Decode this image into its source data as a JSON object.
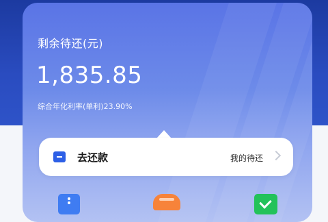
{
  "card": {
    "remaining_label": "剩余待还(元)",
    "amount": "1,835.85",
    "rate_text": "综合年化利率(单利)23.90%"
  },
  "repay_bar": {
    "label": "去还款",
    "link_text": "我的待还"
  },
  "colors": {
    "header_band": "#1c3aa0",
    "card_gradient_top": "#5a74e6",
    "card_gradient_bottom": "#b3c2f3",
    "repay_icon": "#2d5fe6",
    "icon_blue": "#3f7cf2",
    "icon_orange": "#f7833a",
    "icon_green": "#23c25a"
  },
  "bottom_icons": [
    "document-icon",
    "car-icon",
    "check-icon"
  ]
}
